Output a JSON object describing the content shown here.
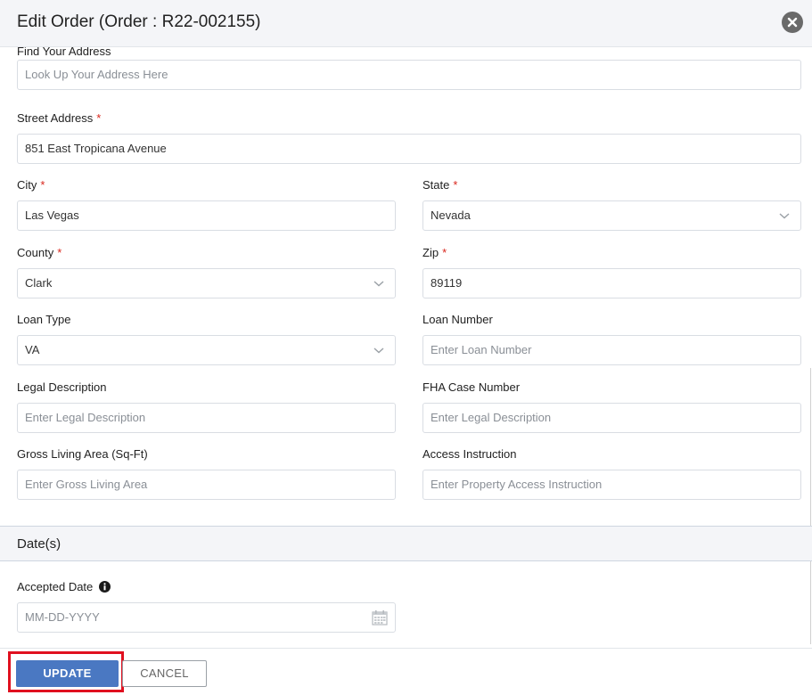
{
  "modal": {
    "title": "Edit Order (Order : R22-002155)"
  },
  "form": {
    "find_address": {
      "label": "Find Your Address",
      "placeholder": "Look Up Your Address Here",
      "value": ""
    },
    "street": {
      "label": "Street Address",
      "required": "*",
      "value": "851 East Tropicana Avenue"
    },
    "city": {
      "label": "City",
      "required": "*",
      "value": "Las Vegas"
    },
    "state": {
      "label": "State",
      "required": "*",
      "value": "Nevada"
    },
    "county": {
      "label": "County",
      "required": "*",
      "value": "Clark"
    },
    "zip": {
      "label": "Zip",
      "required": "*",
      "value": "89119"
    },
    "loan_type": {
      "label": "Loan Type",
      "value": "VA"
    },
    "loan_number": {
      "label": "Loan Number",
      "placeholder": "Enter Loan Number",
      "value": ""
    },
    "legal_description": {
      "label": "Legal Description",
      "placeholder": "Enter Legal Description",
      "value": ""
    },
    "fha_case_number": {
      "label": "FHA Case Number",
      "placeholder": "Enter Legal Description",
      "value": ""
    },
    "gross_living_area": {
      "label": "Gross Living Area (Sq-Ft)",
      "placeholder": "Enter Gross Living Area",
      "value": ""
    },
    "access_instruction": {
      "label": "Access Instruction",
      "placeholder": "Enter Property Access Instruction",
      "value": ""
    }
  },
  "dates_section": {
    "title": "Date(s)",
    "accepted_date": {
      "label": "Accepted Date",
      "placeholder": "MM-DD-YYYY",
      "value": ""
    }
  },
  "footer": {
    "update_label": "UPDATE",
    "cancel_label": "CANCEL"
  },
  "icons": {
    "close": "close-icon",
    "dropdown": "chevron-down-icon",
    "calendar": "calendar-icon",
    "info": "info-icon"
  },
  "colors": {
    "primary_button": "#4a78c2",
    "required_marker": "#d9261c",
    "highlight_box": "#e0101f",
    "header_bg": "#f4f5f8"
  }
}
